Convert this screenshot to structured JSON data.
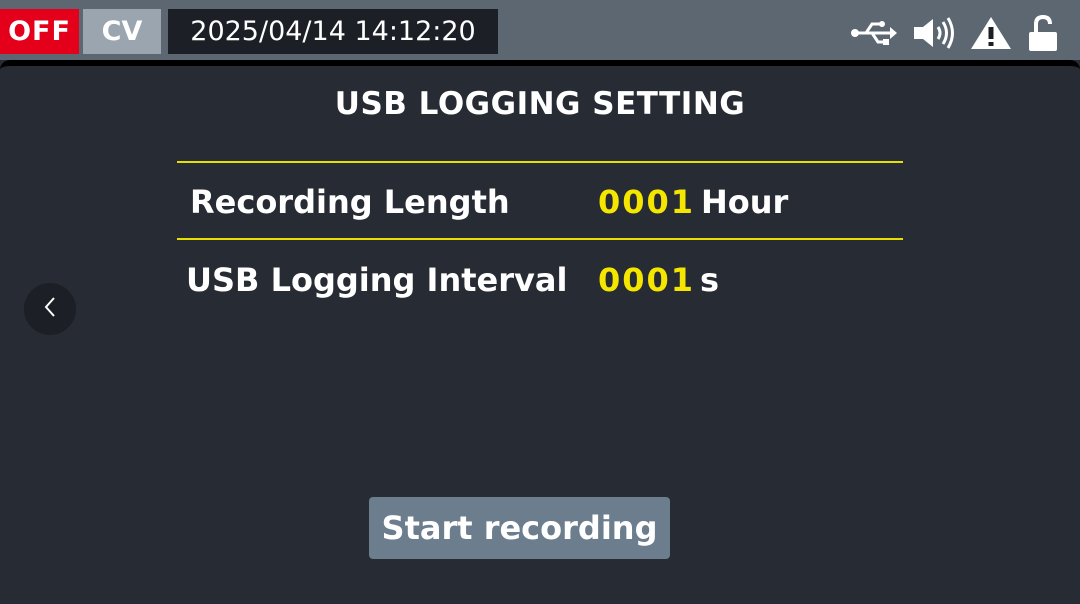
{
  "statusbar": {
    "output_state": "OFF",
    "mode": "CV",
    "datetime": "2025/04/14 14:12:20",
    "icons": [
      "usb-icon",
      "speaker-icon",
      "warning-icon",
      "unlock-icon"
    ],
    "output_color": "#e4001b"
  },
  "page": {
    "title": "USB LOGGING SETTING",
    "rows": [
      {
        "label": "Recording Length",
        "value": "0001",
        "unit": "Hour"
      },
      {
        "label": "USB Logging Interval",
        "value": "0001",
        "unit": "s"
      }
    ],
    "start_button": "Start recording",
    "accent_color": "#f5e600"
  }
}
